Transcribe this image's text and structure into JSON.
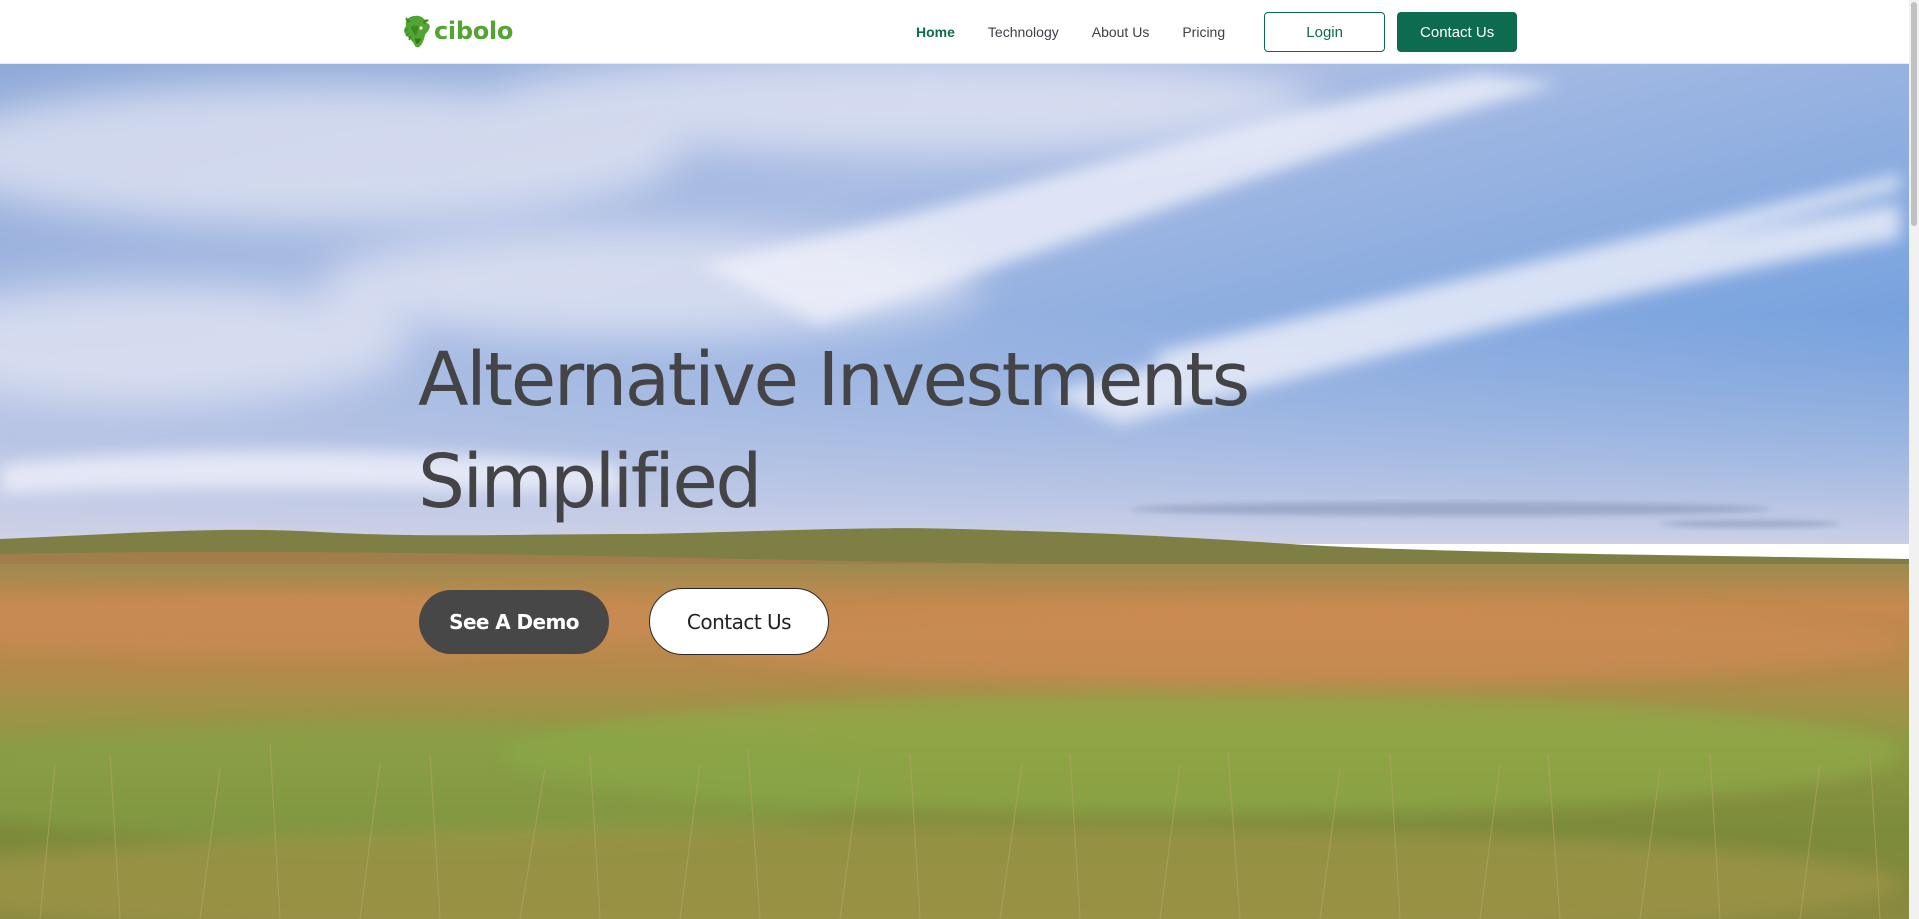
{
  "brand": {
    "name": "cibolo",
    "color": "#52a433"
  },
  "nav": {
    "items": [
      {
        "label": "Home",
        "active": true
      },
      {
        "label": "Technology",
        "active": false
      },
      {
        "label": "About Us",
        "active": false
      },
      {
        "label": "Pricing",
        "active": false
      }
    ],
    "login_label": "Login",
    "contact_label": "Contact Us",
    "accent": "#0d6b50"
  },
  "hero": {
    "title_line1": "Alternative Investments",
    "title_line2": "Simplified",
    "demo_label": "See A Demo",
    "contact_label": "Contact Us",
    "background": "prairie-grassland-under-blue-sky",
    "title_color": "#444446"
  },
  "icons": {
    "logo": "bison-head-icon"
  }
}
